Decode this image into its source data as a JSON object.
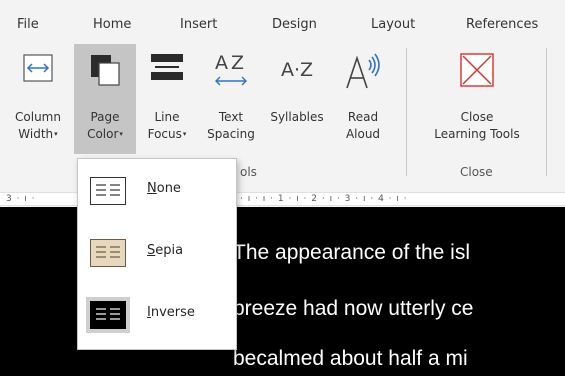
{
  "menu": {
    "tabs": [
      "File",
      "Home",
      "Insert",
      "Design",
      "Layout",
      "References"
    ]
  },
  "ribbon": {
    "buttons": [
      {
        "line1": "Column",
        "line2": "Width",
        "dropdown": true
      },
      {
        "line1": "Page",
        "line2": "Color",
        "dropdown": true
      },
      {
        "line1": "Line",
        "line2": "Focus",
        "dropdown": true
      },
      {
        "line1": "Text",
        "line2": "Spacing",
        "dropdown": false
      },
      {
        "line1": "Syllables",
        "line2": "",
        "dropdown": false
      },
      {
        "line1": "Read",
        "line2": "Aloud",
        "dropdown": false
      },
      {
        "line1": "Close",
        "line2": "Learning Tools",
        "dropdown": false
      }
    ],
    "group_labels": {
      "tools": "ols",
      "close": "Close"
    },
    "icon_text": {
      "text_spacing": "AZ",
      "syllables": "A·Z"
    },
    "dropdown_arrow": "▾"
  },
  "ruler": {
    "left": "3 · ı ·",
    "right": "· ı · ı · 1 · ı · 2 · ı · 3 · ı · 4 · ı ·"
  },
  "page_color_menu": {
    "items": [
      {
        "access_key": "N",
        "rest": "one",
        "swatch": "#ffffff",
        "lines": "#333333"
      },
      {
        "access_key": "S",
        "rest": "epia",
        "swatch": "#e6d7bd",
        "lines": "#6b5a45"
      },
      {
        "access_key": "I",
        "rest": "nverse",
        "swatch": "#000000",
        "lines": "#ffffff",
        "selected": true
      }
    ]
  },
  "document": {
    "lines": [
      "The appearance of the isl",
      "breeze had now utterly ce",
      "becalmed about half a mi"
    ]
  },
  "colors": {
    "close_icon": "#d9302c",
    "accent_blue": "#2f73c2",
    "page_bg": "#000000"
  }
}
